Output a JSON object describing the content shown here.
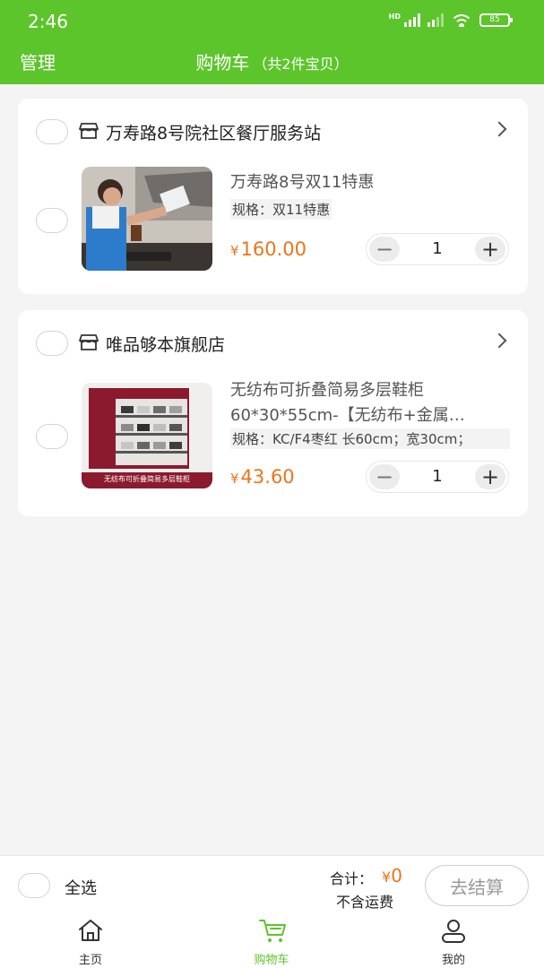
{
  "status_bar": {
    "time": "2:46",
    "network": "HD",
    "battery": "85"
  },
  "header": {
    "manage": "管理",
    "title": "购物车",
    "count": "（共2件宝贝）"
  },
  "shops": [
    {
      "name": "万寿路8号院社区餐厅服务站",
      "product": {
        "title": "万寿路8号双11特惠",
        "spec": "规格：双11特惠",
        "price_symbol": "¥",
        "price": "160.00",
        "quantity": "1"
      }
    },
    {
      "name": "唯品够本旗舰店",
      "product": {
        "title": "无纺布可折叠简易多层鞋柜60*30*55cm-【无纺布+金属…",
        "spec": "规格：KC/F4枣红 长60cm；宽30cm；",
        "price_symbol": "¥",
        "price": "43.60",
        "quantity": "1",
        "image_caption": "无纺布可折叠简易多层鞋柜"
      }
    }
  ],
  "checkout": {
    "select_all": "全选",
    "total_label": "合计：",
    "total_symbol": "¥",
    "total_value": "0",
    "shipping_note": "不含运费",
    "checkout_button": "去结算"
  },
  "tabs": [
    {
      "label": "主页",
      "icon": "home-icon"
    },
    {
      "label": "购物车",
      "icon": "cart-icon",
      "active": true
    },
    {
      "label": "我的",
      "icon": "profile-icon"
    }
  ],
  "colors": {
    "brand_green": "#5cc52b",
    "price_orange": "#e8761d"
  }
}
